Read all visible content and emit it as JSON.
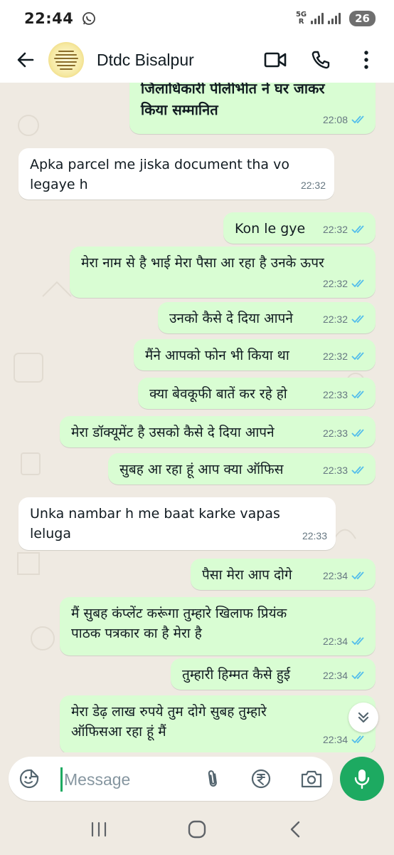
{
  "status_bar": {
    "time": "22:44",
    "network_top": "5G",
    "network_bottom": "R",
    "battery": "26"
  },
  "header": {
    "contact_name": "Dtdc Bisalpur"
  },
  "messages": [
    {
      "dir": "out",
      "text": "जिलाधिकारी पीलीभीत ने घर जाकर\nकिया सम्मानित",
      "time": "22:08",
      "read": true
    },
    {
      "dir": "in",
      "text": "Apka parcel me jiska document tha vo\nlegaye h",
      "time": "22:32"
    },
    {
      "dir": "out",
      "text": "Kon le gye",
      "time": "22:32",
      "read": true
    },
    {
      "dir": "out",
      "text": "मेरा नाम से है भाई मेरा पैसा आ रहा है उनके ऊपर",
      "time": "22:32",
      "read": true
    },
    {
      "dir": "out",
      "text": "उनको कैसे दे दिया आपने",
      "time": "22:32",
      "read": true
    },
    {
      "dir": "out",
      "text": "मैंने आपको फोन भी किया था",
      "time": "22:32",
      "read": true
    },
    {
      "dir": "out",
      "text": "क्या बेवकूफी बातें कर रहे हो",
      "time": "22:33",
      "read": true
    },
    {
      "dir": "out",
      "text": "मेरा डॉक्यूमेंट है उसको कैसे दे दिया आपने",
      "time": "22:33",
      "read": true
    },
    {
      "dir": "out",
      "text": "सुबह आ रहा हूं आप क्या ऑफिस",
      "time": "22:33",
      "read": true
    },
    {
      "dir": "in",
      "text": "Unka nambar h me baat karke vapas\nleluga",
      "time": "22:33"
    },
    {
      "dir": "out",
      "text": "पैसा मेरा आप दोगे",
      "time": "22:34",
      "read": true
    },
    {
      "dir": "out",
      "text": "मैं सुबह कंप्लेंट करूंगा तुम्हारे खिलाफ प्रियंक\nपाठक पत्रकार का है मेरा है",
      "time": "22:34",
      "read": true
    },
    {
      "dir": "out",
      "text": "तुम्हारी हिम्मत कैसे हुई",
      "time": "22:34",
      "read": true
    },
    {
      "dir": "out",
      "text": "मेरा डेढ़ लाख रुपये तुम दोगे सुबह तुम्हारे\nऑफिसआ रहा हूं मैं",
      "time": "22:34",
      "read": true
    }
  ],
  "composer": {
    "placeholder": "Message"
  },
  "colors": {
    "outgoing_bubble": "#d9fdd3",
    "incoming_bubble": "#ffffff",
    "chat_background": "#efeae2",
    "accent_green": "#1daa61",
    "read_ticks": "#53bdeb"
  },
  "icons": [
    "back-arrow-icon",
    "video-call-icon",
    "voice-call-icon",
    "more-options-icon",
    "emoji-sticker-icon",
    "attach-icon",
    "rupee-payment-icon",
    "camera-icon",
    "mic-icon",
    "scroll-down-icon",
    "recent-apps-icon",
    "home-icon",
    "back-nav-icon"
  ]
}
